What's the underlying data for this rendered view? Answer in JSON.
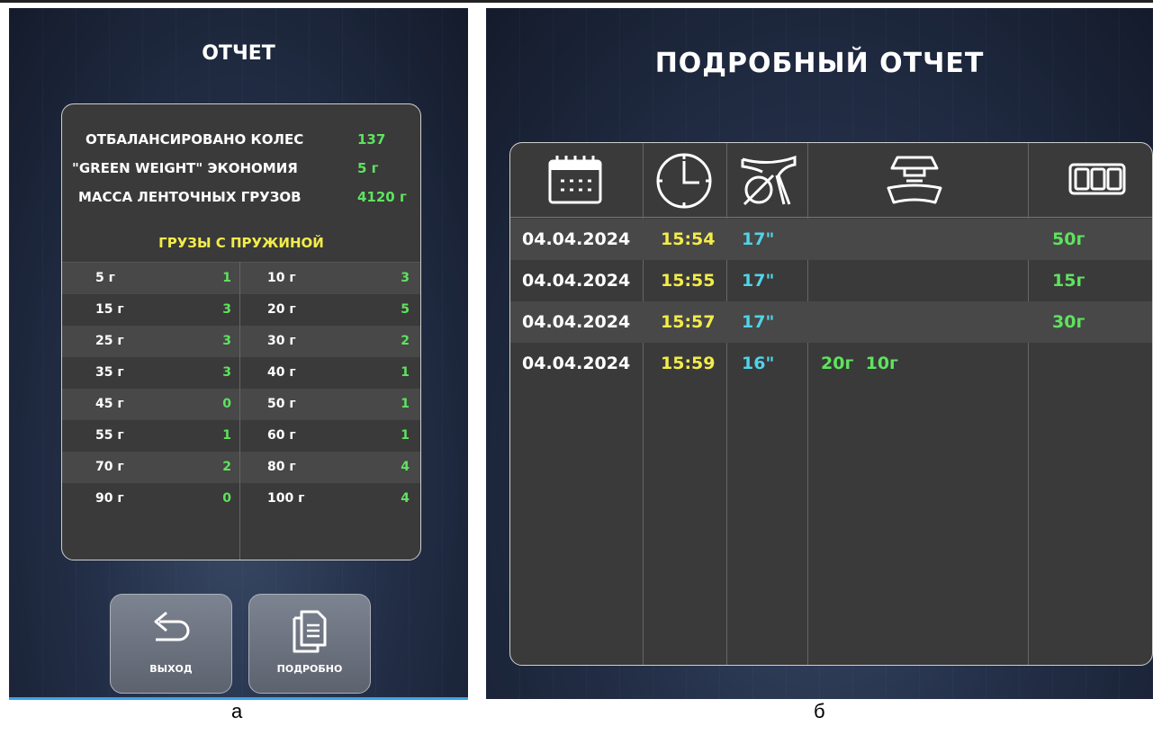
{
  "report": {
    "title": "ОТЧЕТ",
    "stats": [
      {
        "label": "ОТБАЛАНСИРОВАНО КОЛЕС",
        "value": "137"
      },
      {
        "label": "\"GREEN WEIGHT\" ЭКОНОМИЯ",
        "value": "5 г"
      },
      {
        "label": "МАССА ЛЕНТОЧНЫХ ГРУЗОВ",
        "value": "4120 г"
      }
    ],
    "springs_title": "ГРУЗЫ С ПРУЖИНОЙ",
    "weights": [
      {
        "w1": "5 г",
        "n1": "1",
        "w2": "10 г",
        "n2": "3"
      },
      {
        "w1": "15 г",
        "n1": "3",
        "w2": "20 г",
        "n2": "5"
      },
      {
        "w1": "25 г",
        "n1": "3",
        "w2": "30 г",
        "n2": "2"
      },
      {
        "w1": "35 г",
        "n1": "3",
        "w2": "40 г",
        "n2": "1"
      },
      {
        "w1": "45 г",
        "n1": "0",
        "w2": "50 г",
        "n2": "1"
      },
      {
        "w1": "55 г",
        "n1": "1",
        "w2": "60 г",
        "n2": "1"
      },
      {
        "w1": "70 г",
        "n1": "2",
        "w2": "80 г",
        "n2": "4"
      },
      {
        "w1": "90 г",
        "n1": "0",
        "w2": "100 г",
        "n2": "4"
      }
    ],
    "buttons": {
      "exit": "ВЫХОД",
      "detail": "ПОДРОБНО"
    },
    "caption": "а"
  },
  "detail": {
    "title": "ПОДРОБНЫЙ ОТЧЕТ",
    "columns_icons": [
      "calendar-icon",
      "clock-icon",
      "rim-diameter-icon",
      "clip-weights-icon",
      "adhesive-weights-icon"
    ],
    "rows": [
      {
        "date": "04.04.2024",
        "time": "15:54",
        "size": "17\"",
        "clip": "",
        "adhesive": "50г"
      },
      {
        "date": "04.04.2024",
        "time": "15:55",
        "size": "17\"",
        "clip": "",
        "adhesive": "15г"
      },
      {
        "date": "04.04.2024",
        "time": "15:57",
        "size": "17\"",
        "clip": "",
        "adhesive": "30г"
      },
      {
        "date": "04.04.2024",
        "time": "15:59",
        "size": "16\"",
        "clip": "20г  10г",
        "adhesive": ""
      }
    ],
    "caption": "б"
  },
  "colors": {
    "green": "#5ee35e",
    "yellow": "#f3ec4a",
    "cyan": "#4fd4e8",
    "panel": "#3a3a3a"
  }
}
